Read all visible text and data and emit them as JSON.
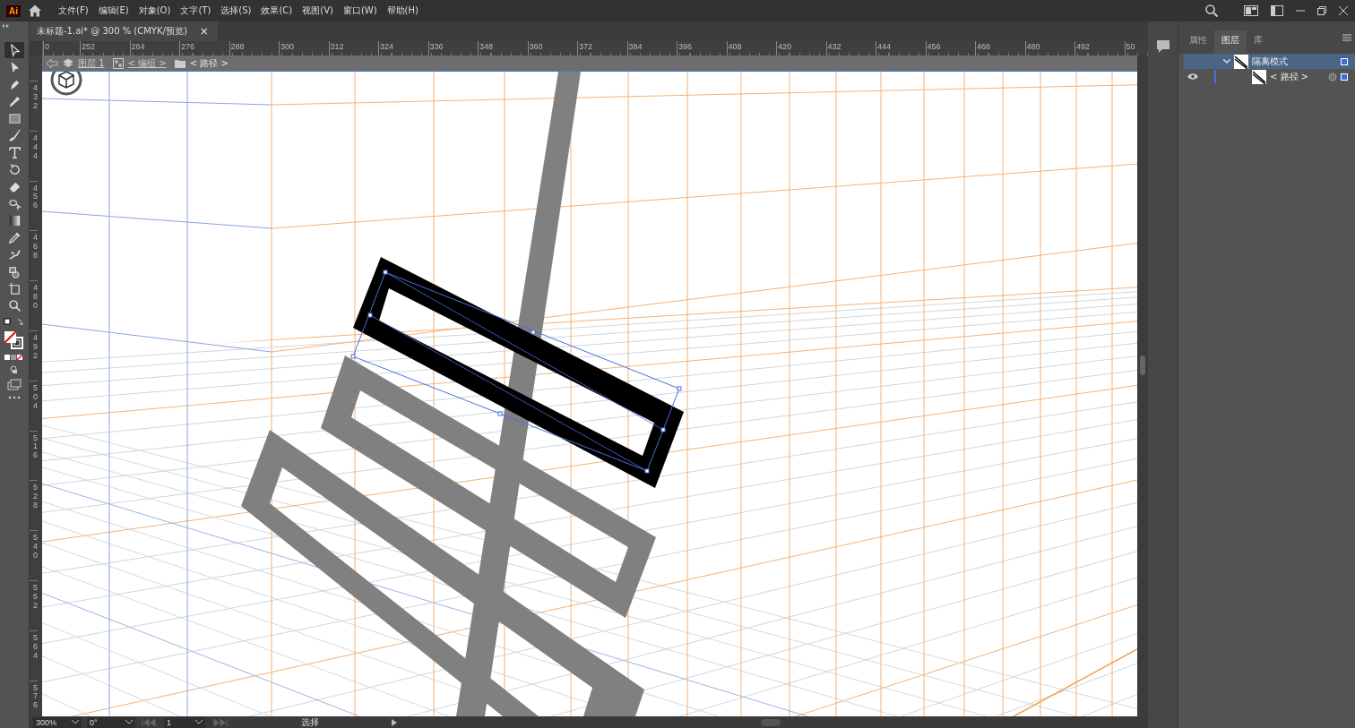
{
  "app": {
    "logo": "Ai"
  },
  "menu": [
    "文件(F)",
    "编辑(E)",
    "对象(O)",
    "文字(T)",
    "选择(S)",
    "效果(C)",
    "视图(V)",
    "窗口(W)",
    "帮助(H)"
  ],
  "document_tab": {
    "title": "未标题-1.ai* @ 300 % (CMYK/预览)",
    "close": "×"
  },
  "rulers": {
    "horizontal": [
      "0",
      "252",
      "264",
      "276",
      "288",
      "300",
      "312",
      "324",
      "336",
      "348",
      "360",
      "372",
      "384",
      "396",
      "408",
      "420",
      "432",
      "444",
      "456",
      "468",
      "480",
      "492",
      "50"
    ],
    "vertical": [
      "432",
      "444",
      "456",
      "468",
      "480",
      "492",
      "504",
      "516",
      "528",
      "540",
      "552",
      "564",
      "576"
    ]
  },
  "breadcrumb": [
    {
      "label": "图层 1",
      "kind": "layer"
    },
    {
      "label": "< 编组 >",
      "kind": "group"
    },
    {
      "label": "< 路径 >",
      "kind": "path"
    }
  ],
  "tools": [
    {
      "kind": "selection",
      "selected": true
    },
    {
      "kind": "direct-selection",
      "selected": false
    },
    {
      "kind": "pen",
      "selected": false
    },
    {
      "kind": "curvature",
      "selected": false
    },
    {
      "kind": "rectangle",
      "selected": false
    },
    {
      "kind": "paintbrush",
      "selected": false
    },
    {
      "kind": "type",
      "selected": false
    },
    {
      "kind": "rotate",
      "selected": false
    },
    {
      "kind": "eraser",
      "selected": false
    },
    {
      "kind": "shape-builder",
      "selected": false
    },
    {
      "kind": "gradient",
      "selected": false
    },
    {
      "kind": "eyedropper",
      "selected": false
    },
    {
      "kind": "puppet-warp",
      "selected": false
    },
    {
      "kind": "live-paint",
      "selected": false
    },
    {
      "kind": "artboard",
      "selected": false
    },
    {
      "kind": "zoom",
      "selected": false
    }
  ],
  "panel": {
    "tabs": [
      {
        "label": "属性",
        "selected": false
      },
      {
        "label": "图层",
        "selected": true
      },
      {
        "label": "库",
        "selected": false
      }
    ],
    "layers": [
      {
        "name": "隔离模式",
        "expanded": true,
        "selected": true,
        "children": [
          {
            "name": "< 路径 >",
            "visible": true,
            "selected": false
          }
        ]
      }
    ]
  },
  "status_bar": {
    "zoom": "300%",
    "rotation": "0°",
    "artboard": "1",
    "tool": "选择"
  }
}
